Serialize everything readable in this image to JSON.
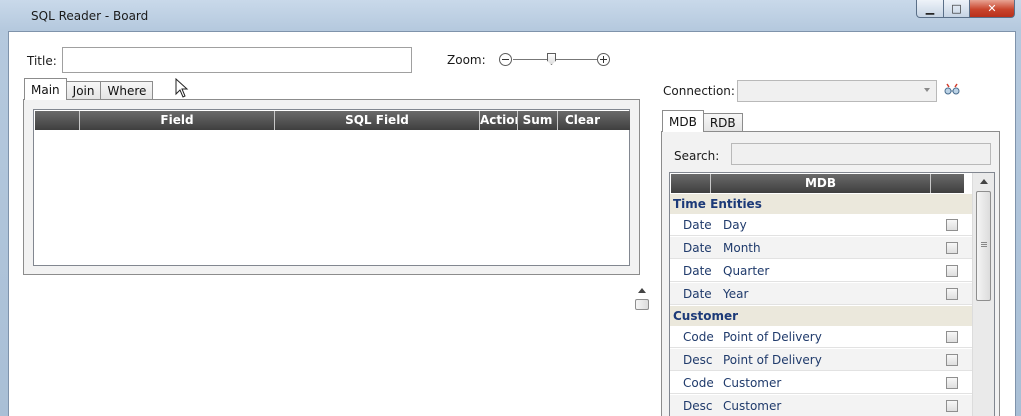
{
  "window": {
    "title": "SQL Reader - Board",
    "controls": {
      "minimize": "▁",
      "maximize": "□",
      "close": "✕"
    }
  },
  "form": {
    "title_label": "Title:",
    "title_value": "",
    "zoom_label": "Zoom:",
    "connection_label": "Connection:",
    "connection_value": "",
    "connect_icon": "connect-icon"
  },
  "left_tabs": [
    {
      "label": "Main",
      "active": true
    },
    {
      "label": "Join"
    },
    {
      "label": "Where"
    }
  ],
  "main_grid": {
    "columns": [
      "",
      "Field",
      "SQL Field",
      "Action",
      "Sum",
      "Clear"
    ]
  },
  "right_tabs": [
    {
      "label": "MDB",
      "active": true
    },
    {
      "label": "RDB"
    }
  ],
  "search": {
    "label": "Search:",
    "value": ""
  },
  "mdb_list": {
    "header": "MDB",
    "groups": [
      {
        "name": "Time Entities",
        "items": [
          {
            "type": "Date",
            "name": "Day",
            "checked": false
          },
          {
            "type": "Date",
            "name": "Month",
            "checked": false
          },
          {
            "type": "Date",
            "name": "Quarter",
            "checked": false
          },
          {
            "type": "Date",
            "name": "Year",
            "checked": false
          }
        ]
      },
      {
        "name": "Customer",
        "items": [
          {
            "type": "Code",
            "name": "Point of Delivery",
            "checked": false
          },
          {
            "type": "Desc",
            "name": "Point of Delivery",
            "checked": false
          },
          {
            "type": "Code",
            "name": "Customer",
            "checked": false
          },
          {
            "type": "Desc",
            "name": "Customer",
            "checked": false
          }
        ]
      }
    ]
  }
}
